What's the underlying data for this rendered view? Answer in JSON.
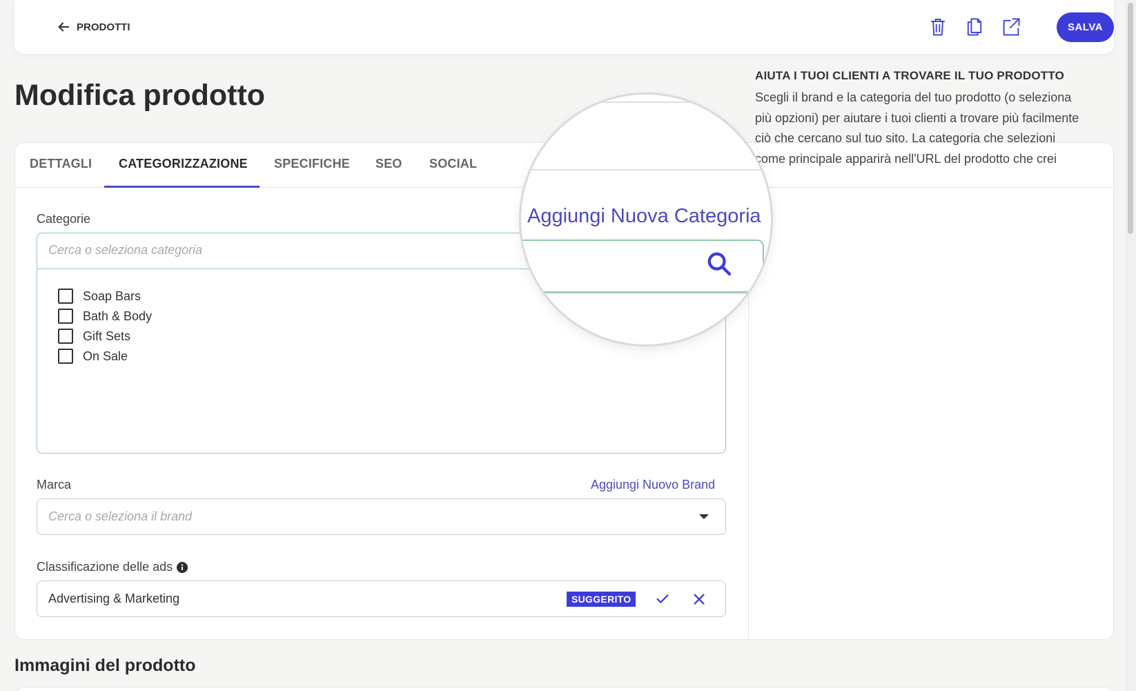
{
  "header": {
    "back_label": "PRODOTTI",
    "icons": [
      "trash-icon",
      "copy-icon",
      "external-link-icon"
    ],
    "save_label": "SALVA",
    "accent_color": "#3c3cdb"
  },
  "page_title": "Modifica prodotto",
  "tabs": [
    {
      "label": "DETTAGLI",
      "active": false
    },
    {
      "label": "CATEGORIZZAZIONE",
      "active": true
    },
    {
      "label": "SPECIFICHE",
      "active": false
    },
    {
      "label": "SEO",
      "active": false
    },
    {
      "label": "SOCIAL",
      "active": false
    }
  ],
  "categories": {
    "label": "Categorie",
    "add_link": "Aggiungi Nuova Categoria",
    "search_placeholder": "Cerca o seleziona categoria",
    "items": [
      {
        "label": "Soap Bars",
        "checked": false
      },
      {
        "label": "Bath & Body",
        "checked": false
      },
      {
        "label": "Gift Sets",
        "checked": false
      },
      {
        "label": "On Sale",
        "checked": false
      }
    ]
  },
  "brand": {
    "label": "Marca",
    "add_link": "Aggiungi Nuovo Brand",
    "placeholder": "Cerca o seleziona il brand"
  },
  "ads": {
    "label": "Classificazione delle ads",
    "value": "Advertising & Marketing",
    "badge": "SUGGERITO"
  },
  "help": {
    "title": "AIUTA I TUOI CLIENTI A TROVARE IL TUO PRODOTTO",
    "text": "Scegli il brand e la categoria del tuo prodotto (o seleziona più opzioni) per aiutare i tuoi clienti a trovare più facilmente ciò che cercano sul tuo sito. La categoria che selezioni come principale apparirà nell'URL del prodotto che crei"
  },
  "images_section_title": "Immagini del prodotto",
  "magnifier": {
    "link_text": "Aggiungi Nuova Categoria",
    "icon": "search-icon"
  }
}
